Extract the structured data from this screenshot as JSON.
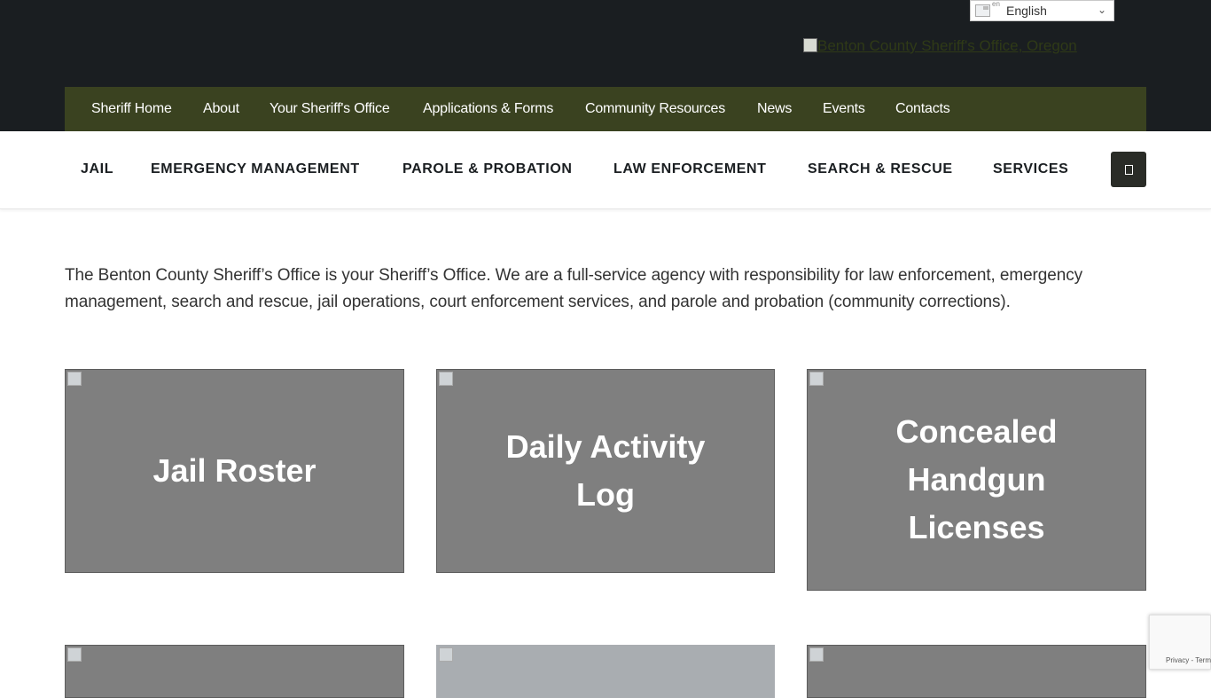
{
  "language": {
    "code": "en",
    "label": "English"
  },
  "logo": {
    "alt": "Benton County Sheriff's Office, Oregon"
  },
  "main_nav": [
    "Sheriff Home",
    "About",
    "Your Sheriff's Office",
    "Applications & Forms",
    "Community Resources",
    "News",
    "Events",
    "Contacts"
  ],
  "secondary_nav": [
    "JAIL",
    "EMERGENCY MANAGEMENT",
    "PAROLE & PROBATION",
    "LAW ENFORCEMENT",
    "SEARCH & RESCUE",
    "SERVICES"
  ],
  "intro": "The Benton County Sheriff’s Office is your Sheriff’s Office. We are a full-service agency with responsibility for law enforcement, emergency management, search and rescue, jail operations, court enforcement services, and parole and probation (community corrections).",
  "cards": [
    {
      "title": "Jail Roster"
    },
    {
      "title": "Daily Activity Log"
    },
    {
      "title": "Concealed Handgun Licenses"
    }
  ],
  "recaptcha": {
    "privacy": "Privacy",
    "separator": " - ",
    "terms": "Terms"
  },
  "colors": {
    "topbar": "#1a1e21",
    "main_nav_bg": "#3a4220",
    "card_bg": "#7f7f7f"
  }
}
